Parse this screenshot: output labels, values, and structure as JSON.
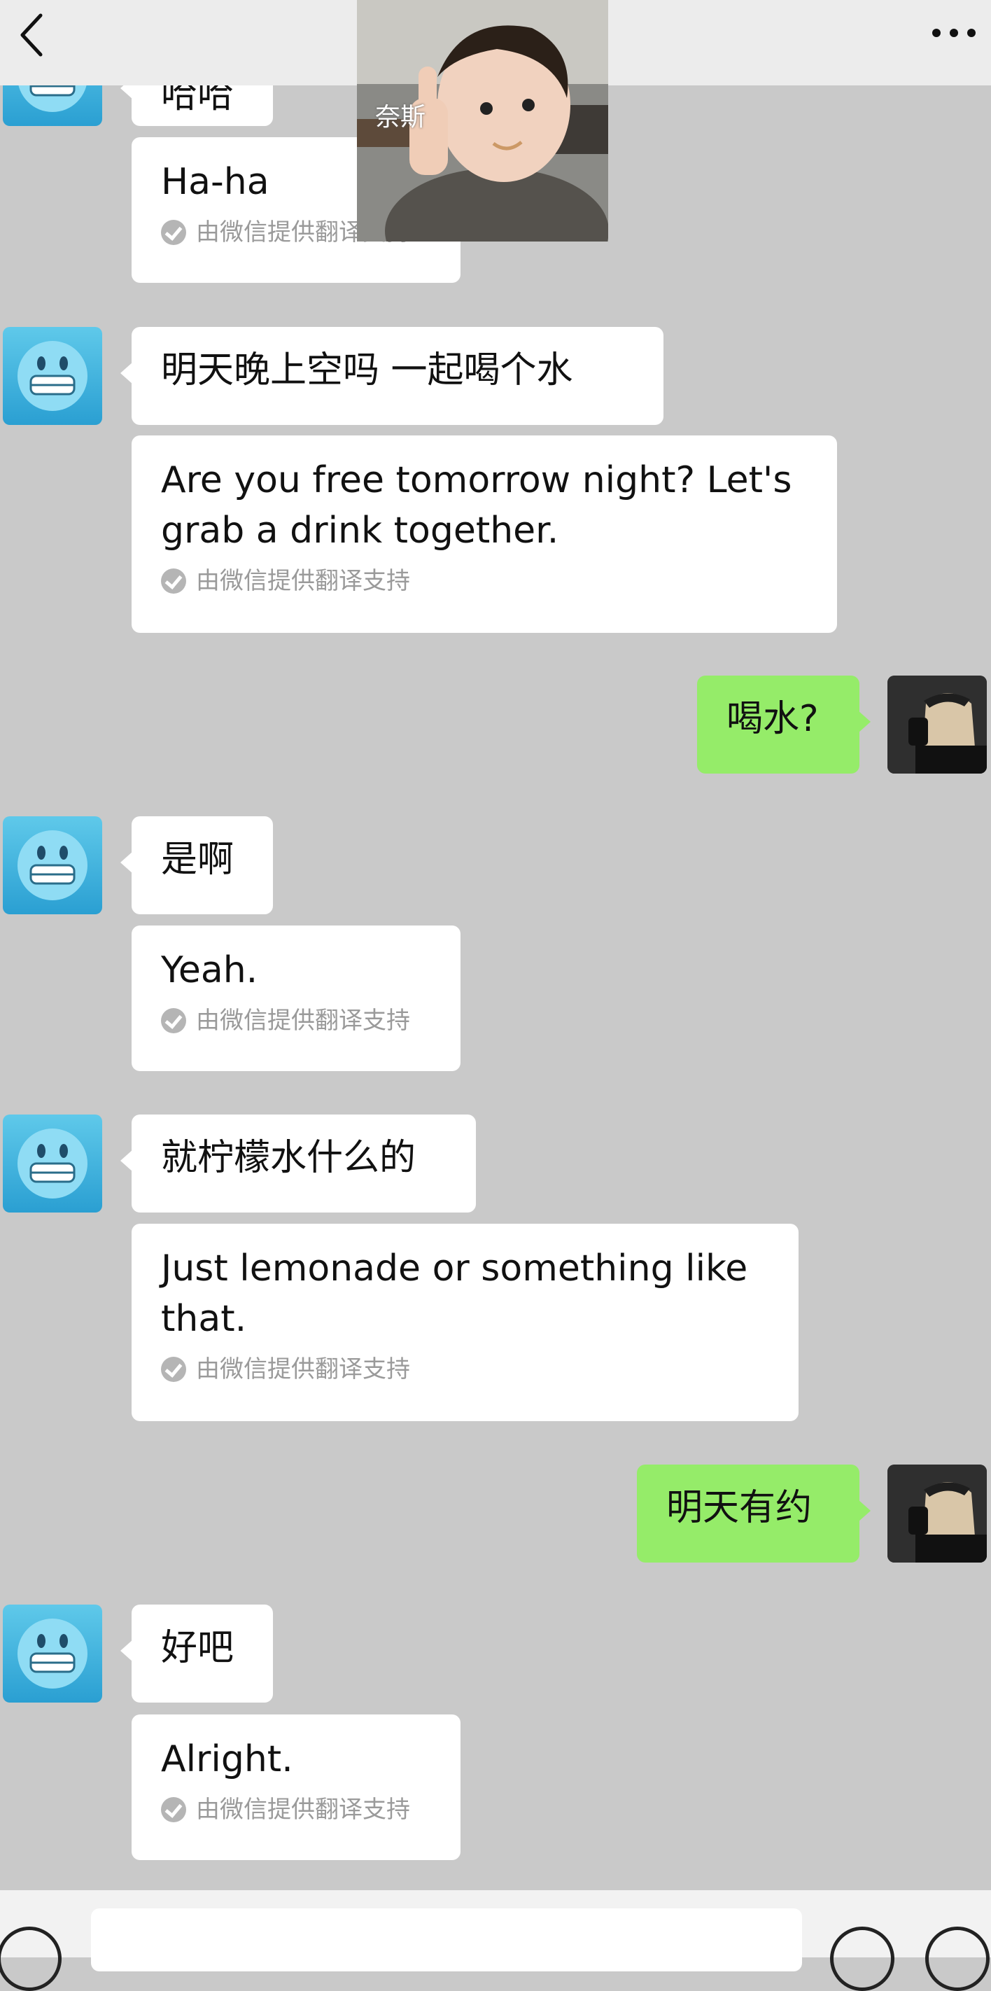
{
  "nav": {
    "back_icon": "chevron-left-icon",
    "more_icon": "ellipsis-icon"
  },
  "sticker": {
    "caption": "奈斯"
  },
  "messages": [
    {
      "side": "left",
      "text": "哈哈"
    },
    {
      "side": "left-translation",
      "text": "Ha-ha",
      "note": "由微信提供翻译支持"
    },
    {
      "side": "left",
      "text": "明天晚上空吗  一起喝个水"
    },
    {
      "side": "left-translation",
      "text": "Are you free tomorrow night? Let's grab a drink together.",
      "note": "由微信提供翻译支持"
    },
    {
      "side": "right",
      "text": "喝水?"
    },
    {
      "side": "left",
      "text": "是啊"
    },
    {
      "side": "left-translation",
      "text": "Yeah.",
      "note": "由微信提供翻译支持"
    },
    {
      "side": "left",
      "text": "就柠檬水什么的"
    },
    {
      "side": "left-translation",
      "text": "Just lemonade or something like that.",
      "note": "由微信提供翻译支持"
    },
    {
      "side": "right",
      "text": "明天有约"
    },
    {
      "side": "left",
      "text": "好吧"
    },
    {
      "side": "left-translation",
      "text": "Alright.",
      "note": "由微信提供翻译支持"
    }
  ],
  "colors": {
    "background": "#c9c9c9",
    "outgoing_bubble": "#95ec69",
    "incoming_bubble": "#ffffff"
  }
}
